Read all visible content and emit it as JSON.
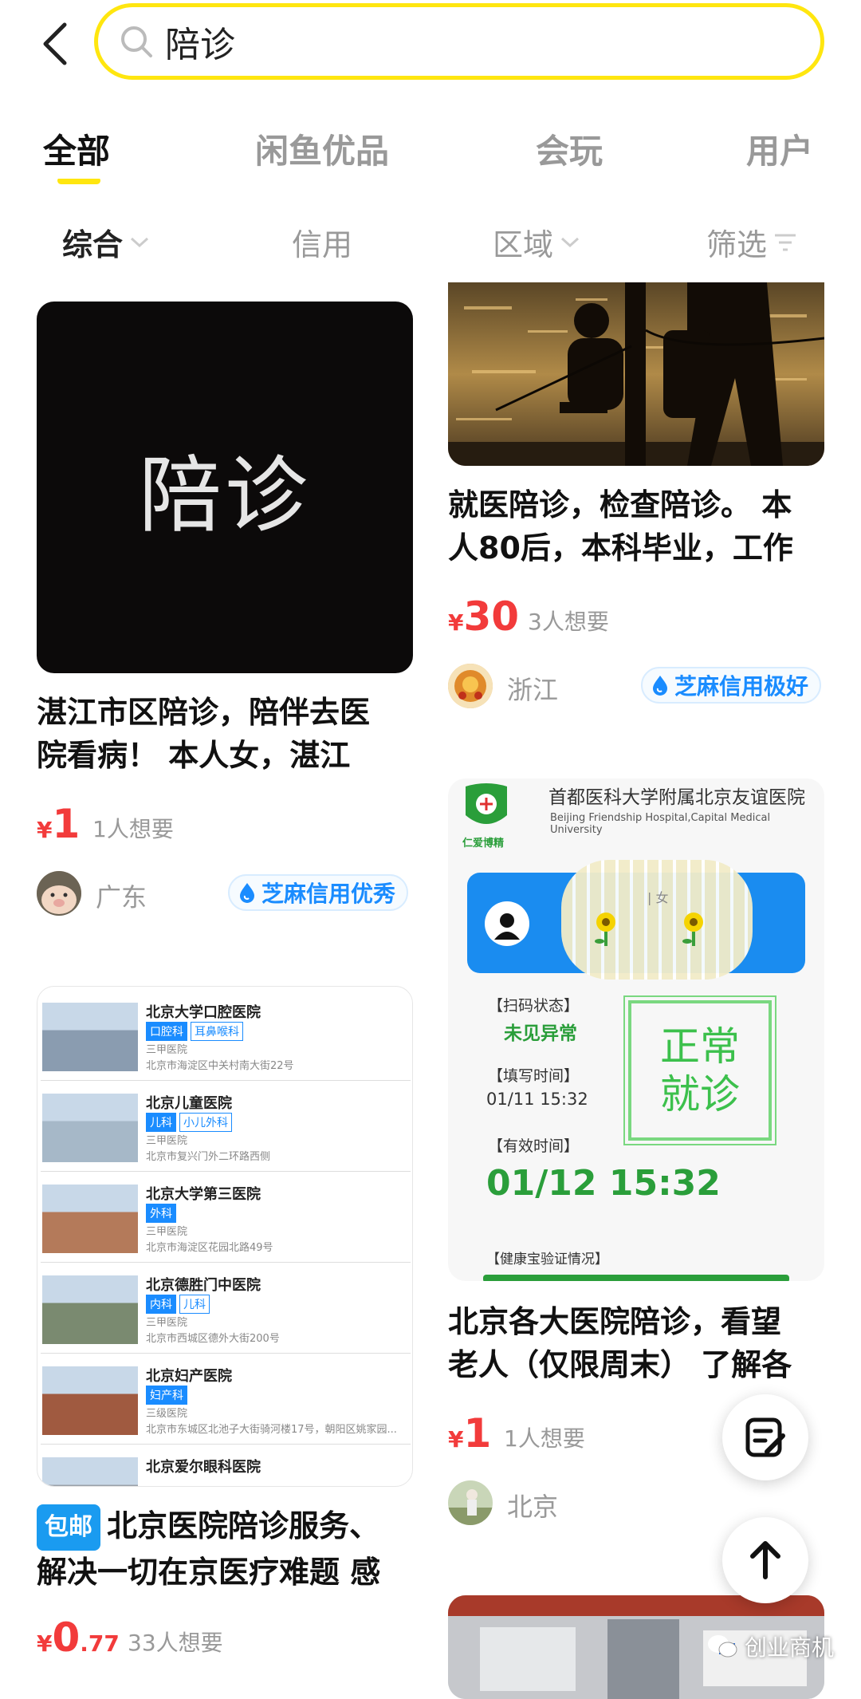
{
  "search": {
    "value": "陪诊"
  },
  "tabs": [
    "全部",
    "闲鱼优品",
    "会玩",
    "用户"
  ],
  "filters": [
    "综合",
    "信用",
    "区域",
    "筛选"
  ],
  "cards": {
    "c1": {
      "image_text": "陪诊",
      "title_l1": "湛江市区陪诊，陪伴去医",
      "title_l2": "院看病！ 本人女，湛江",
      "price": "1",
      "want": "1人想要",
      "location": "广东",
      "badge": "芝麻信用优秀"
    },
    "c2": {
      "title_l1": "就医陪诊，检查陪诊。 本",
      "title_l2": "人80后，本科毕业，工作",
      "price": "30",
      "want": "3人想要",
      "location": "浙江",
      "badge": "芝麻信用极好"
    },
    "c3": {
      "tag": "包邮",
      "title_l1": "北京医院陪诊服务、",
      "title_l2": "解决一切在京医疗难题 感",
      "price": "0",
      "price_dec": ".77",
      "want": "33人想要"
    },
    "c4": {
      "title_l1": "北京各大医院陪诊，看望",
      "title_l2": "老人（仅限周末） 了解各",
      "price": "1",
      "want": "1人想要",
      "location": "北京"
    }
  },
  "currency": "¥",
  "hospitals": [
    {
      "name": "北京大学口腔医院",
      "tags": [
        "口腔科",
        "耳鼻喉科"
      ],
      "level": "三甲医院",
      "addr": "北京市海淀区中关村南大街22号"
    },
    {
      "name": "北京儿童医院",
      "tags": [
        "儿科",
        "小儿外科"
      ],
      "level": "三甲医院",
      "addr": "北京市复兴门外二环路西侧"
    },
    {
      "name": "北京大学第三医院",
      "tags": [
        "外科"
      ],
      "level": "三甲医院",
      "addr": "北京市海淀区花园北路49号"
    },
    {
      "name": "北京德胜门中医院",
      "tags": [
        "内科",
        "儿科"
      ],
      "level": "三甲医院",
      "addr": "北京市西城区德外大街200号"
    },
    {
      "name": "北京妇产医院",
      "tags": [
        "妇产科"
      ],
      "level": "三级医院",
      "addr": "北京市东城区北池子大街骑河楼17号，朝阳区姚家园..."
    },
    {
      "name": "北京爱尔眼科医院",
      "tags": [],
      "level": "",
      "addr": ""
    }
  ],
  "health_code": {
    "hospital_cn": "首都医科大学附属北京友谊医院",
    "hospital_en": "Beijing Friendship Hospital,Capital Medical University",
    "logo_text": "仁爱博精",
    "gender": "| 女",
    "scan_label": "【扫码状态】",
    "scan_value": "未见异常",
    "fill_label": "【填写时间】",
    "fill_value": "01/11 15:32",
    "valid_label": "【有效时间】",
    "valid_value": "01/12 15:32",
    "stamp_l1": "正常",
    "stamp_l2": "就诊",
    "health_label": "【健康宝验证情况】"
  },
  "watermark": "创业商机",
  "colors": {
    "accent": "#ffe60f",
    "price": "#f23b3b",
    "credit": "#1a8cff"
  }
}
